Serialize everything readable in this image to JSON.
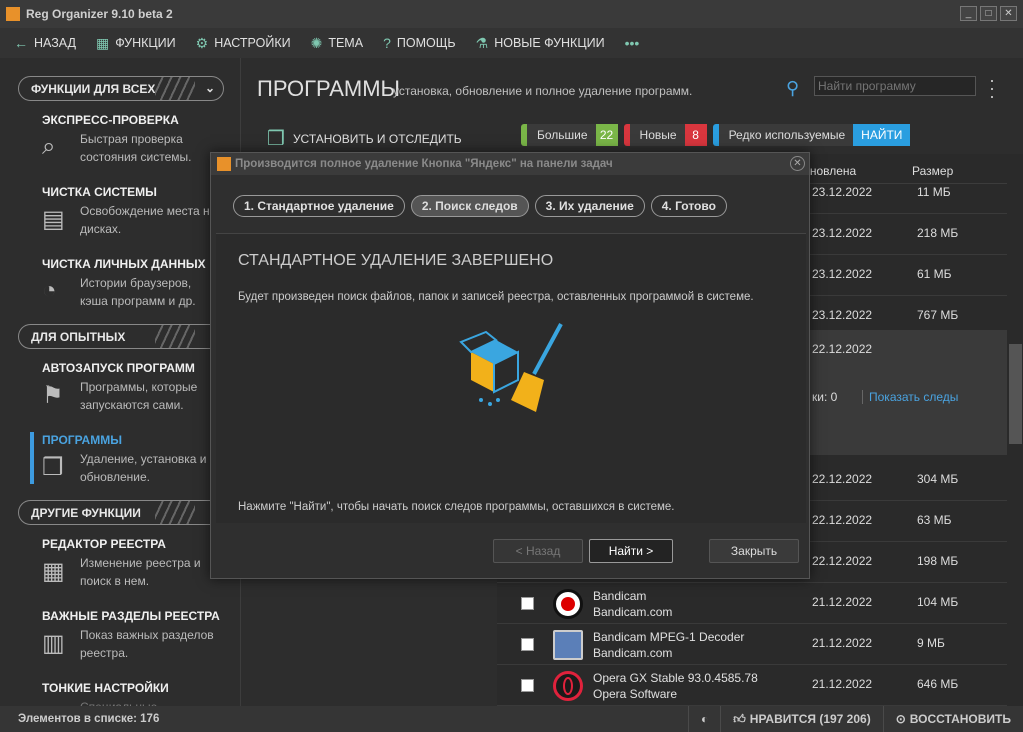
{
  "window": {
    "title": "Reg Organizer 9.10 beta 2",
    "controls": [
      "_",
      "□",
      "✕"
    ]
  },
  "menu": [
    {
      "label": "НАЗАД",
      "icon": "arrow-left-icon",
      "glyph": "←"
    },
    {
      "label": "ФУНКЦИИ",
      "icon": "toolbox-icon",
      "glyph": "▦"
    },
    {
      "label": "НАСТРОЙКИ",
      "icon": "gear-icon",
      "glyph": "⚙"
    },
    {
      "label": "ТЕМА",
      "icon": "bulb-icon",
      "glyph": "✺"
    },
    {
      "label": "ПОМОЩЬ",
      "icon": "help-icon",
      "glyph": "?"
    },
    {
      "label": "НОВЫЕ ФУНКЦИИ",
      "icon": "flask-icon",
      "glyph": "⚗"
    },
    {
      "label": "",
      "icon": "more-icon",
      "glyph": "•••"
    }
  ],
  "sidebar": {
    "sections": [
      "ФУНКЦИИ ДЛЯ ВСЕХ",
      "ДЛЯ ОПЫТНЫХ",
      "ДРУГИЕ ФУНКЦИИ"
    ],
    "items": [
      {
        "title": "ЭКСПРЕСС-ПРОВЕРКА",
        "desc": "Быстрая проверка состояния системы.",
        "icon": "magnifier-check-icon"
      },
      {
        "title": "ЧИСТКА СИСТЕМЫ",
        "desc": "Освобождение места на дисках.",
        "icon": "disk-clean-icon"
      },
      {
        "title": "ЧИСТКА ЛИЧНЫХ ДАННЫХ",
        "desc": "Истории браузеров, кэша программ и др.",
        "icon": "privacy-icon"
      },
      {
        "title": "АВТОЗАПУСК ПРОГРАММ",
        "desc": "Программы, которые запускаются сами.",
        "icon": "autostart-icon"
      },
      {
        "title": "ПРОГРАММЫ",
        "desc": "Удаление, установка и обновление.",
        "icon": "programs-icon"
      },
      {
        "title": "РЕДАКТОР РЕЕСТРА",
        "desc": "Изменение реестра и поиск в нем.",
        "icon": "registry-editor-icon"
      },
      {
        "title": "ВАЖНЫЕ РАЗДЕЛЫ РЕЕСТРА",
        "desc": "Показ важных разделов реестра.",
        "icon": "registry-keys-icon"
      },
      {
        "title": "ТОНКИЕ НАСТРОЙКИ",
        "desc": "Специальные",
        "icon": "tweaks-icon"
      }
    ]
  },
  "main": {
    "title": "ПРОГРАММЫ",
    "subtitle": "установка, обновление и полное удаление программ.",
    "search_placeholder": "Найти программу",
    "install_label": "УСТАНОВИТЬ И ОТСЛЕДИТЬ",
    "filters": [
      {
        "label": "Большие",
        "count": "22",
        "color": "#7ab648"
      },
      {
        "label": "Новые",
        "count": "8",
        "color": "#d9363e"
      },
      {
        "label": "Редко используемые",
        "count": "",
        "color": "#2a9ee0"
      }
    ],
    "find_label": "НАЙТИ",
    "columns": {
      "installed": "Установлена",
      "size": "Размер"
    },
    "rows": [
      {
        "date": "23.12.2022",
        "size": "11 МБ"
      },
      {
        "date": "23.12.2022",
        "size": "218 МБ"
      },
      {
        "date": "23.12.2022",
        "size": "61 МБ"
      },
      {
        "date": "23.12.2022",
        "size": "767 МБ"
      },
      {
        "date": "22.12.2022",
        "size": ""
      },
      {
        "date": "22.12.2022",
        "size": "304 МБ"
      },
      {
        "date": "22.12.2022",
        "size": "63 МБ"
      },
      {
        "date": "22.12.2022",
        "size": "198 МБ"
      },
      {
        "name": "Bandicam",
        "publisher": "Bandicam.com",
        "date": "21.12.2022",
        "size": "104 МБ"
      },
      {
        "name": "Bandicam MPEG-1 Decoder",
        "publisher": "Bandicam.com",
        "date": "21.12.2022",
        "size": "9 МБ"
      },
      {
        "name": "Opera GX Stable 93.0.4585.78",
        "publisher": "Opera Software",
        "date": "21.12.2022",
        "size": "646 МБ"
      }
    ],
    "expanded": {
      "traces_label": "ки: 0",
      "show_traces": "Показать следы"
    }
  },
  "dialog": {
    "title": "Производится полное удаление Кнопка \"Яндекс\" на панели задач",
    "steps": [
      "1. Стандартное удаление",
      "2. Поиск следов",
      "3. Их удаление",
      "4. Готово"
    ],
    "heading": "СТАНДАРТНОЕ УДАЛЕНИЕ ЗАВЕРШЕНО",
    "text1": "Будет произведен поиск файлов, папок и записей реестра, оставленных программой в системе.",
    "text2": "Нажмите \"Найти\", чтобы начать поиск следов программы, оставшихся в системе.",
    "back": "< Назад",
    "next": "Найти >",
    "close": "Закрыть"
  },
  "status": {
    "count": "Элементов в списке: 176",
    "like": "НРАВИТСЯ (197 206)",
    "restore": "ВОССТАНОВИТЬ"
  },
  "colors": {
    "accent": "#2a9ee0",
    "brand": "#e8912a"
  }
}
